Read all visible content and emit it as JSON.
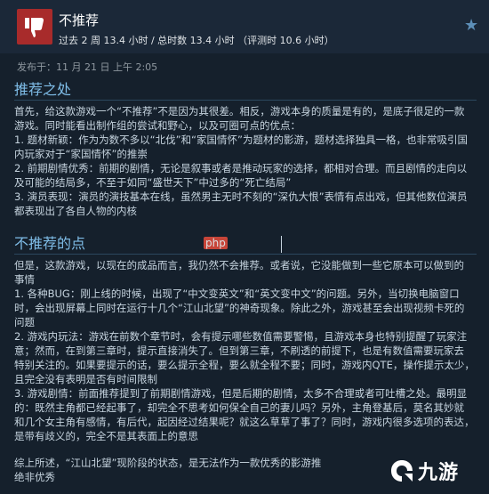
{
  "header": {
    "verdict": "不推荐",
    "hours": "过去 2 周 13.4 小时 / 总时数 13.4 小时 （评测时 10.6 小时）",
    "thumb_icon": "thumbs-down-icon",
    "thumb_bg": "#a82b2b",
    "star_icon": "star-icon"
  },
  "posted": "发布于：11 月 21 日 上午 2:05",
  "pros": {
    "title": "推荐之处",
    "lines": [
      "首先，给这款游戏一个“不推荐”不是因为其很差。相反，游戏本身的质量是有的，是底子很足的一款",
      "游戏。同时能看出制作组的尝试和野心，以及可圈可点的优点：",
      "1. 题材新颖：作为为数不多以“北伐”和“家国情怀”为题材的影游，题材选择独具一格，也非常吸引国",
      "内玩家对于“家国情怀”的推崇",
      "2. 前期剧情优秀：前期的剧情，无论是叙事或者是推动玩家的选择，都相对合理。而且剧情的走向以",
      "及可能的结局多，不至于如同“盛世天下”中过多的“死亡结局”",
      "3. 演员表现：演员的演技基本在线，虽然男主无时不刻的“深仇大恨”表情有点出戏，但其他数位演员",
      "都表现出了各自人物的内核"
    ]
  },
  "cons": {
    "title": "不推荐的点",
    "lines": [
      "但是，这款游戏，以现在的成品而言，我仍然不会推荐。或者说，它没能做到一些它原本可以做到的",
      "事情",
      "1. 各种BUG：刚上线的时候，出现了“中文变英文”和“英文变中文”的问题。另外，当切换电脑窗口",
      "时，会出现屏幕上同时在运行十几个“江山北望”的神奇现象。除此之外，游戏甚至会出现视频卡死的",
      "问题",
      "2. 游戏内玩法：游戏在前数个章节时，会有提示哪些数值需要警惕，且游戏本身也特别提醒了玩家注",
      "意；然而，在到第三章时，提示直接消失了。但到第三章，不刷透的前提下，也是有数值需要玩家去",
      "特别关注的。如果要提示的话，要么提示全程，要么就全程不要；同时，游戏内QTE，操作提示太少，",
      "且完全没有表明是否有时间限制",
      "3. 游戏剧情：前面推荐提到了前期剧情游戏，但是后期的剧情，太多不合理或者可吐槽之处。最明显",
      "的：既然主角都已经起事了，却完全不思考如何保全自己的妻儿吗？另外，主角登基后，莫名其妙就",
      "和几个女主角有感情，有后代，起因经过结果呢？就这么草草了事了？同时，游戏内很多选项的表达，",
      "是带有歧义的，完全不是其表面上的意思"
    ]
  },
  "summary": [
    "综上所述，“江山北望”现阶段的状态，是无法作为一款优秀的影游推",
    "绝非优秀"
  ],
  "watermarks": {
    "php": "php",
    "jiuyou_icon": "jiuyou-logo-icon",
    "jiuyou_text": "九游"
  },
  "colors": {
    "accent_blue": "#7fbde8",
    "background": "#15202c"
  }
}
